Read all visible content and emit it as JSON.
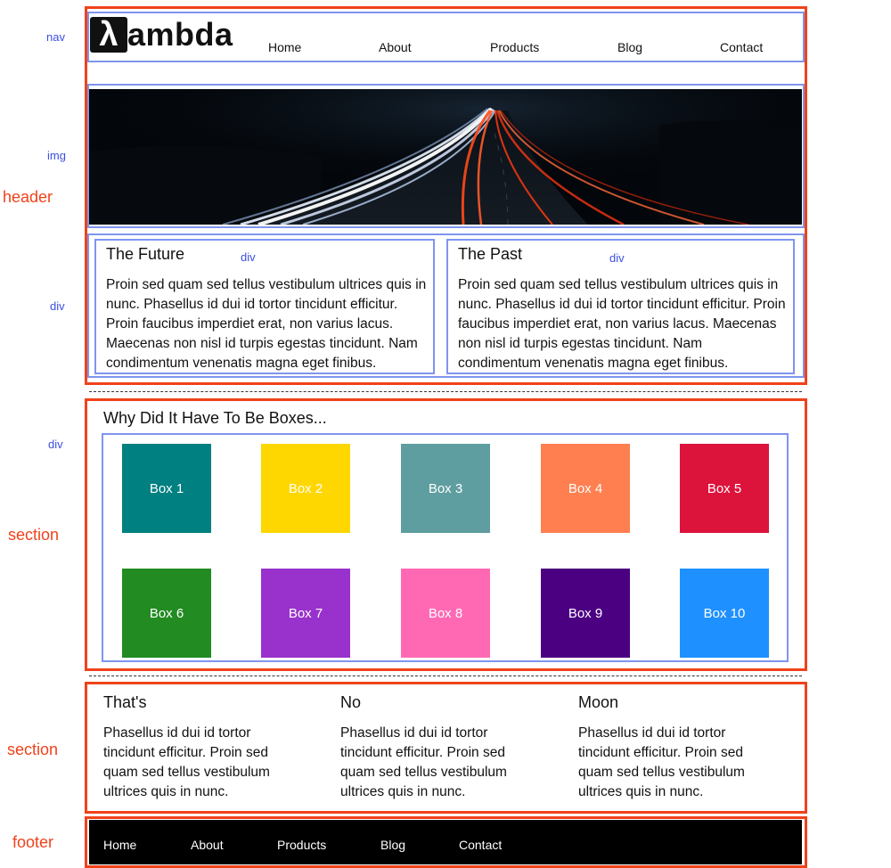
{
  "annotations": {
    "nav": "nav",
    "img": "img",
    "header": "header",
    "div_left": "div",
    "div_col1": "div",
    "div_col2": "div",
    "div_boxes": "div",
    "section1": "section",
    "section2": "section",
    "footer": "footer"
  },
  "brand": {
    "logo_mark": "λ",
    "logo_text": "ambda"
  },
  "nav": {
    "items": [
      "Home",
      "About",
      "Products",
      "Blog",
      "Contact"
    ]
  },
  "columns": [
    {
      "title": "The Future",
      "text": "Proin sed quam sed tellus vestibulum ultrices quis in nunc. Phasellus id dui id tortor tincidunt efficitur. Proin faucibus imperdiet erat, non varius lacus. Maecenas non nisl id turpis egestas tincidunt. Nam condimentum venenatis magna eget finibus."
    },
    {
      "title": "The Past",
      "text": "Proin sed quam sed tellus vestibulum ultrices quis in nunc. Phasellus id dui id tortor tincidunt efficitur. Proin faucibus imperdiet erat, non varius lacus. Maecenas non nisl id turpis egestas tincidunt. Nam condimentum venenatis magna eget finibus."
    }
  ],
  "boxes_section": {
    "title": "Why Did It Have To Be Boxes...",
    "boxes": [
      {
        "label": "Box 1",
        "color": "#008080"
      },
      {
        "label": "Box 2",
        "color": "#FFD700"
      },
      {
        "label": "Box 3",
        "color": "#5F9EA0"
      },
      {
        "label": "Box 4",
        "color": "#FF7F50"
      },
      {
        "label": "Box 5",
        "color": "#DC143C"
      },
      {
        "label": "Box 6",
        "color": "#228B22"
      },
      {
        "label": "Box 7",
        "color": "#9932CC"
      },
      {
        "label": "Box 8",
        "color": "#FF69B4"
      },
      {
        "label": "Box 9",
        "color": "#4B0082"
      },
      {
        "label": "Box 10",
        "color": "#1E90FF"
      }
    ]
  },
  "bottom_section": {
    "columns": [
      {
        "title": "That's",
        "text": "Phasellus id dui id tortor tincidunt efficitur. Proin sed quam sed tellus vestibulum ultrices quis in nunc."
      },
      {
        "title": "No",
        "text": "Phasellus id dui id tortor tincidunt efficitur. Proin sed quam sed tellus vestibulum ultrices quis in nunc."
      },
      {
        "title": "Moon",
        "text": "Phasellus id dui id tortor tincidunt efficitur. Proin sed quam sed tellus vestibulum ultrices quis in nunc."
      }
    ]
  },
  "footer": {
    "items": [
      "Home",
      "About",
      "Products",
      "Blog",
      "Contact"
    ]
  },
  "colors": {
    "annotation_red": "#f0421b",
    "annotation_blue": "#7f95ee",
    "footer_bg": "#000000"
  }
}
